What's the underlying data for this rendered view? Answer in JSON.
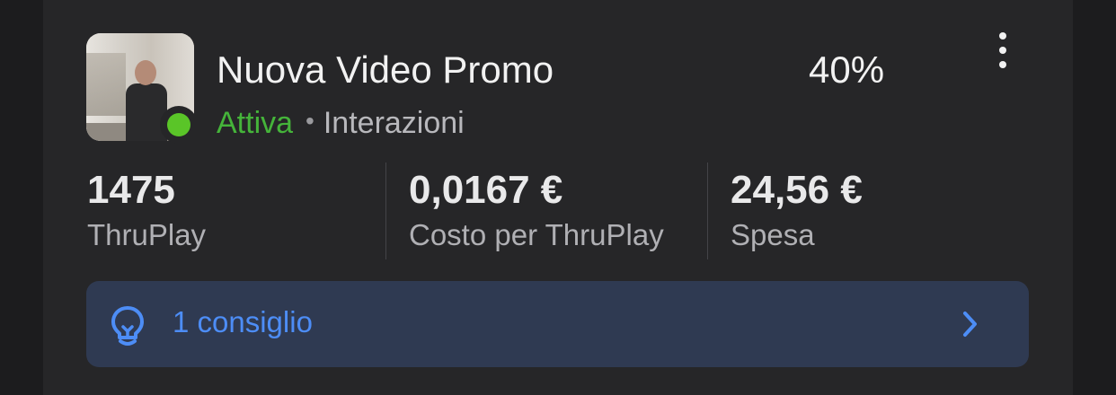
{
  "ad": {
    "title": "Nuova Video Promo",
    "percent": "40%",
    "status": "Attiva",
    "separator": "•",
    "objective": "Interazioni",
    "thumbnail_icon": "video-thumbnail",
    "more_icon": "more-vertical-icon"
  },
  "metrics": [
    {
      "value": "1475",
      "label": "ThruPlay"
    },
    {
      "value": "0,0167 €",
      "label": "Costo per ThruPlay"
    },
    {
      "value": "24,56 €",
      "label": "Spesa"
    }
  ],
  "tip": {
    "label": "1 consiglio",
    "icon": "lightbulb-icon",
    "chevron_icon": "chevron-right-icon"
  },
  "colors": {
    "background": "#1c1c1e",
    "card": "#262628",
    "active_green": "#45b43a",
    "status_dot": "#5ac528",
    "tip_background": "#2f3a52",
    "accent_blue": "#4d8df6"
  }
}
